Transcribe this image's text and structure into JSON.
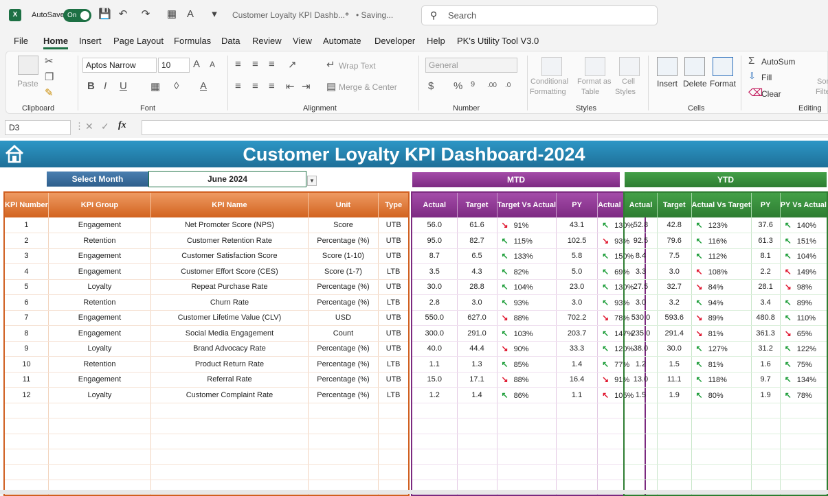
{
  "titlebar": {
    "autosave_label": "AutoSave",
    "autosave_state": "On",
    "doc_title": "Customer Loyalty KPI Dashb...",
    "saving": "• Saving...",
    "search_placeholder": "Search"
  },
  "menu": [
    "File",
    "Home",
    "Insert",
    "Page Layout",
    "Formulas",
    "Data",
    "Review",
    "View",
    "Automate",
    "Developer",
    "Help",
    "PK's Utility Tool V3.0"
  ],
  "ribbon": {
    "clipboard": {
      "paste": "Paste",
      "label": "Clipboard"
    },
    "font": {
      "name": "Aptos Narrow",
      "size": "10",
      "label": "Font"
    },
    "alignment": {
      "wrap": "Wrap Text",
      "merge": "Merge & Center",
      "label": "Alignment"
    },
    "number": {
      "format": "General",
      "label": "Number"
    },
    "styles": {
      "conditional": "Conditional",
      "conditional2": "Formatting",
      "format_as": "Format as",
      "format_as2": "Table",
      "cell": "Cell",
      "cell2": "Styles",
      "label": "Styles"
    },
    "cells": {
      "insert": "Insert",
      "delete": "Delete",
      "format": "Format",
      "label": "Cells"
    },
    "editing": {
      "autosum": "AutoSum",
      "fill": "Fill",
      "clear": "Clear",
      "label": "Editing",
      "sort": "Sor",
      "filter": "Filte"
    }
  },
  "formula": {
    "namebox": "D3",
    "fx": "fx"
  },
  "dashboard": {
    "title": "Customer Loyalty KPI Dashboard-2024",
    "select_month_label": "Select Month",
    "selected_month": "June 2024",
    "mtd_label": "MTD",
    "ytd_label": "YTD",
    "kpi_headers": [
      "KPI Number",
      "KPI Group",
      "KPI Name",
      "Unit",
      "Type"
    ],
    "mtd_headers": [
      "Actual",
      "Target",
      "Target Vs Actual",
      "PY",
      "Actual Vs PY"
    ],
    "ytd_headers": [
      "Actual",
      "Target",
      "Actual Vs Target",
      "PY",
      "PY Vs Actual"
    ],
    "rows": [
      {
        "n": "1",
        "group": "Engagement",
        "name": "Net Promoter Score (NPS)",
        "unit": "Score",
        "type": "UTB",
        "m_act": "56.0",
        "m_tgt": "61.6",
        "m_tva_dir": "down",
        "m_tva": "91%",
        "m_py": "43.1",
        "m_avp_dir": "up",
        "m_avp": "130%",
        "y_act": "52.8",
        "y_tgt": "42.8",
        "y_avt_dir": "up",
        "y_avt": "123%",
        "y_py": "37.6",
        "y_pva_dir": "up",
        "y_pva": "140%"
      },
      {
        "n": "2",
        "group": "Retention",
        "name": "Customer Retention Rate",
        "unit": "Percentage (%)",
        "type": "UTB",
        "m_act": "95.0",
        "m_tgt": "82.7",
        "m_tva_dir": "up",
        "m_tva": "115%",
        "m_py": "102.5",
        "m_avp_dir": "down",
        "m_avp": "93%",
        "y_act": "92.5",
        "y_tgt": "79.6",
        "y_avt_dir": "up",
        "y_avt": "116%",
        "y_py": "61.3",
        "y_pva_dir": "up",
        "y_pva": "151%"
      },
      {
        "n": "3",
        "group": "Engagement",
        "name": "Customer Satisfaction Score",
        "unit": "Score (1-10)",
        "type": "UTB",
        "m_act": "8.7",
        "m_tgt": "6.5",
        "m_tva_dir": "up",
        "m_tva": "133%",
        "m_py": "5.8",
        "m_avp_dir": "up",
        "m_avp": "150%",
        "y_act": "8.4",
        "y_tgt": "7.5",
        "y_avt_dir": "up",
        "y_avt": "112%",
        "y_py": "8.1",
        "y_pva_dir": "up",
        "y_pva": "104%"
      },
      {
        "n": "4",
        "group": "Engagement",
        "name": "Customer Effort Score (CES)",
        "unit": "Score (1-7)",
        "type": "LTB",
        "m_act": "3.5",
        "m_tgt": "4.3",
        "m_tva_dir": "up",
        "m_tva": "82%",
        "m_py": "5.0",
        "m_avp_dir": "up",
        "m_avp": "69%",
        "y_act": "3.3",
        "y_tgt": "3.0",
        "y_avt_dir": "bad",
        "y_avt": "108%",
        "y_py": "2.2",
        "y_pva_dir": "bad",
        "y_pva": "149%"
      },
      {
        "n": "5",
        "group": "Loyalty",
        "name": "Repeat Purchase Rate",
        "unit": "Percentage (%)",
        "type": "UTB",
        "m_act": "30.0",
        "m_tgt": "28.8",
        "m_tva_dir": "up",
        "m_tva": "104%",
        "m_py": "23.0",
        "m_avp_dir": "up",
        "m_avp": "130%",
        "y_act": "27.5",
        "y_tgt": "32.7",
        "y_avt_dir": "down",
        "y_avt": "84%",
        "y_py": "28.1",
        "y_pva_dir": "down",
        "y_pva": "98%"
      },
      {
        "n": "6",
        "group": "Retention",
        "name": "Churn Rate",
        "unit": "Percentage (%)",
        "type": "LTB",
        "m_act": "2.8",
        "m_tgt": "3.0",
        "m_tva_dir": "up",
        "m_tva": "93%",
        "m_py": "3.0",
        "m_avp_dir": "up",
        "m_avp": "93%",
        "y_act": "3.0",
        "y_tgt": "3.2",
        "y_avt_dir": "up",
        "y_avt": "94%",
        "y_py": "3.4",
        "y_pva_dir": "up",
        "y_pva": "89%"
      },
      {
        "n": "7",
        "group": "Engagement",
        "name": "Customer Lifetime Value (CLV)",
        "unit": "USD",
        "type": "UTB",
        "m_act": "550.0",
        "m_tgt": "627.0",
        "m_tva_dir": "down",
        "m_tva": "88%",
        "m_py": "702.2",
        "m_avp_dir": "down",
        "m_avp": "78%",
        "y_act": "530.0",
        "y_tgt": "593.6",
        "y_avt_dir": "down",
        "y_avt": "89%",
        "y_py": "480.8",
        "y_pva_dir": "up",
        "y_pva": "110%"
      },
      {
        "n": "8",
        "group": "Engagement",
        "name": "Social Media Engagement",
        "unit": "Count",
        "type": "UTB",
        "m_act": "300.0",
        "m_tgt": "291.0",
        "m_tva_dir": "up",
        "m_tva": "103%",
        "m_py": "203.7",
        "m_avp_dir": "up",
        "m_avp": "147%",
        "y_act": "235.0",
        "y_tgt": "291.4",
        "y_avt_dir": "down",
        "y_avt": "81%",
        "y_py": "361.3",
        "y_pva_dir": "down",
        "y_pva": "65%"
      },
      {
        "n": "9",
        "group": "Loyalty",
        "name": "Brand Advocacy Rate",
        "unit": "Percentage (%)",
        "type": "UTB",
        "m_act": "40.0",
        "m_tgt": "44.4",
        "m_tva_dir": "down",
        "m_tva": "90%",
        "m_py": "33.3",
        "m_avp_dir": "up",
        "m_avp": "120%",
        "y_act": "38.0",
        "y_tgt": "30.0",
        "y_avt_dir": "up",
        "y_avt": "127%",
        "y_py": "31.2",
        "y_pva_dir": "up",
        "y_pva": "122%"
      },
      {
        "n": "10",
        "group": "Retention",
        "name": "Product Return Rate",
        "unit": "Percentage (%)",
        "type": "LTB",
        "m_act": "1.1",
        "m_tgt": "1.3",
        "m_tva_dir": "up",
        "m_tva": "85%",
        "m_py": "1.4",
        "m_avp_dir": "up",
        "m_avp": "77%",
        "y_act": "1.2",
        "y_tgt": "1.5",
        "y_avt_dir": "up",
        "y_avt": "81%",
        "y_py": "1.6",
        "y_pva_dir": "up",
        "y_pva": "75%"
      },
      {
        "n": "11",
        "group": "Engagement",
        "name": "Referral Rate",
        "unit": "Percentage (%)",
        "type": "UTB",
        "m_act": "15.0",
        "m_tgt": "17.1",
        "m_tva_dir": "down",
        "m_tva": "88%",
        "m_py": "16.4",
        "m_avp_dir": "down",
        "m_avp": "91%",
        "y_act": "13.0",
        "y_tgt": "11.1",
        "y_avt_dir": "up",
        "y_avt": "118%",
        "y_py": "9.7",
        "y_pva_dir": "up",
        "y_pva": "134%"
      },
      {
        "n": "12",
        "group": "Loyalty",
        "name": "Customer Complaint Rate",
        "unit": "Percentage (%)",
        "type": "LTB",
        "m_act": "1.2",
        "m_tgt": "1.4",
        "m_tva_dir": "up",
        "m_tva": "86%",
        "m_py": "1.1",
        "m_avp_dir": "bad",
        "m_avp": "105%",
        "y_act": "1.5",
        "y_tgt": "1.9",
        "y_avt_dir": "up",
        "y_avt": "80%",
        "y_py": "1.9",
        "y_pva_dir": "up",
        "y_pva": "78%"
      }
    ]
  }
}
